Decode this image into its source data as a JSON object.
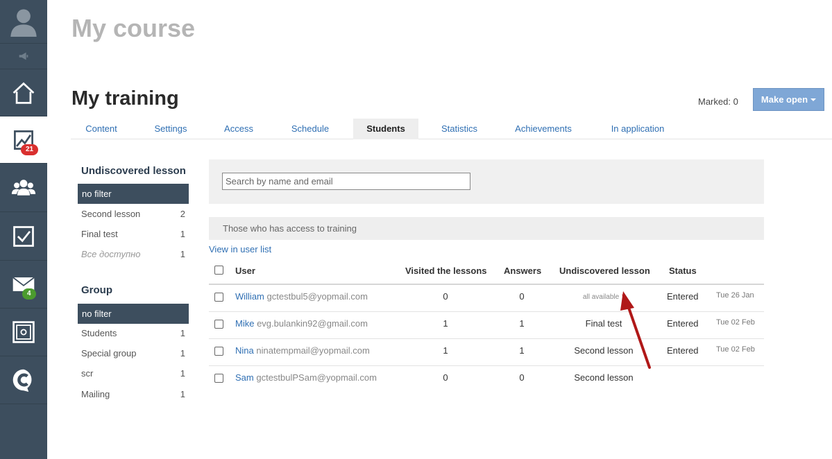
{
  "rail": {
    "items": [
      {
        "icon": "avatar-icon"
      },
      {
        "icon": "megaphone-icon"
      },
      {
        "icon": "home-icon"
      },
      {
        "icon": "chart-icon",
        "badge": "21",
        "active": true
      },
      {
        "icon": "users-icon"
      },
      {
        "icon": "checkbox-icon"
      },
      {
        "icon": "mail-icon",
        "badge": "4"
      },
      {
        "icon": "safe-icon"
      },
      {
        "icon": "logo-c-icon"
      }
    ]
  },
  "header": {
    "course_title": "My course",
    "training_title": "My training",
    "marked_label": "Marked: 0",
    "make_open_label": "Make open"
  },
  "tabs": [
    {
      "label": "Content"
    },
    {
      "label": "Settings"
    },
    {
      "label": "Access"
    },
    {
      "label": "Schedule"
    },
    {
      "label": "Students",
      "active": true
    },
    {
      "label": "Statistics"
    },
    {
      "label": "Achievements"
    },
    {
      "label": "In application"
    }
  ],
  "sidebar": {
    "undiscovered": {
      "heading": "Undiscovered lesson",
      "active_filter": "no filter",
      "items": [
        {
          "label": "Second lesson",
          "count": "2"
        },
        {
          "label": "Final test",
          "count": "1"
        },
        {
          "label": "Все доступно",
          "count": "1"
        }
      ]
    },
    "group": {
      "heading": "Group",
      "active_filter": "no filter",
      "items": [
        {
          "label": "Students",
          "count": "1"
        },
        {
          "label": "Special group",
          "count": "1"
        },
        {
          "label": "scr",
          "count": "1"
        },
        {
          "label": "Mailing",
          "count": "1"
        }
      ]
    }
  },
  "main": {
    "search_placeholder": "Search by name and email",
    "access_text": "Those who has access to training",
    "view_link": "View in user list",
    "columns": {
      "user": "User",
      "visited": "Visited the lessons",
      "answers": "Answers",
      "undiscovered": "Undiscovered lesson",
      "status": "Status"
    },
    "rows": [
      {
        "name": "William",
        "email": "gctestbul5@yopmail.com",
        "visited": "0",
        "answers": "0",
        "undiscovered": "all available",
        "asterisk": "*",
        "status": "Entered",
        "date": "Tue 26 Jan"
      },
      {
        "name": "Mike",
        "email": "evg.bulankin92@gmail.com",
        "visited": "1",
        "answers": "1",
        "undiscovered": "Final test",
        "status": "Entered",
        "date": "Tue 02 Feb"
      },
      {
        "name": "Nina",
        "email": "ninatempmail@yopmail.com",
        "visited": "1",
        "answers": "1",
        "undiscovered": "Second lesson",
        "status": "Entered",
        "date": "Tue 02 Feb"
      },
      {
        "name": "Sam",
        "email": "gctestbulPSam@yopmail.com",
        "visited": "0",
        "answers": "0",
        "undiscovered": "Second lesson",
        "status": "",
        "date": ""
      }
    ]
  },
  "colors": {
    "rail_bg": "#3d4e5e",
    "link": "#2f6fb3",
    "button": "#7fa7d6",
    "badge_red": "#d9302f",
    "badge_green": "#4b9b2e",
    "arrow": "#b01818"
  }
}
